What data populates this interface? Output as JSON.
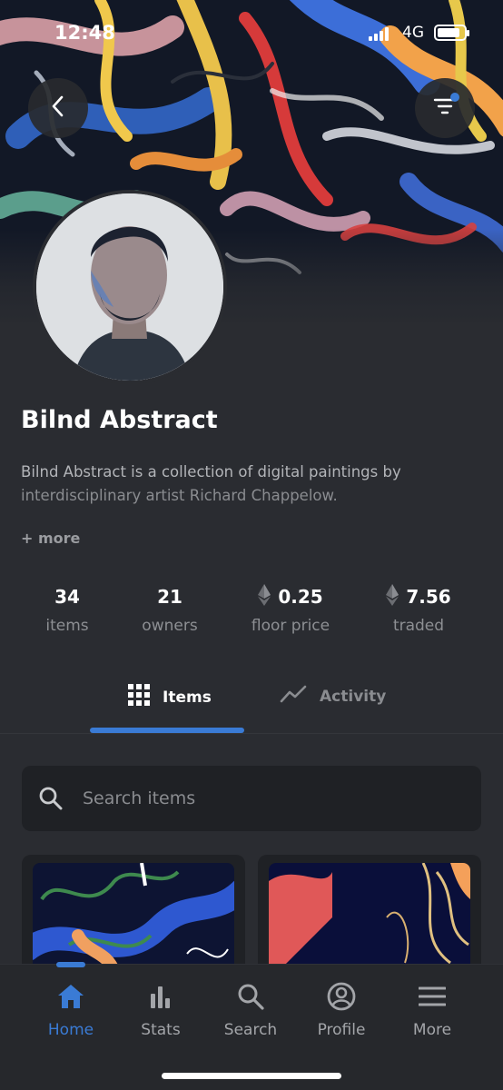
{
  "status_bar": {
    "time": "12:48",
    "network": "4G"
  },
  "collection": {
    "name": "Bilnd Abstract",
    "description_line1": "Bilnd Abstract is a collection of digital paintings by",
    "description_line2": "interdisciplinary artist Richard Chappelow.",
    "more_label": "+ more"
  },
  "stats": [
    {
      "value": "34",
      "label": "items"
    },
    {
      "value": "21",
      "label": "owners"
    },
    {
      "value": "0.25",
      "label": "floor price",
      "icon": "ethereum-icon"
    },
    {
      "value": "7.56",
      "label": "traded",
      "icon": "ethereum-icon"
    }
  ],
  "tabs": [
    {
      "label": "Items",
      "icon": "grid-icon",
      "active": true
    },
    {
      "label": "Activity",
      "icon": "trend-line-icon",
      "active": false
    }
  ],
  "search": {
    "placeholder": "Search items",
    "value": ""
  },
  "bottom_nav": [
    {
      "label": "Home",
      "icon": "home-icon",
      "active": true
    },
    {
      "label": "Stats",
      "icon": "bar-chart-icon"
    },
    {
      "label": "Search",
      "icon": "search-icon"
    },
    {
      "label": "Profile",
      "icon": "profile-icon"
    },
    {
      "label": "More",
      "icon": "menu-icon"
    }
  ],
  "colors": {
    "accent": "#3a7bd5",
    "background": "#2a2c31",
    "surface": "#1f2125"
  }
}
